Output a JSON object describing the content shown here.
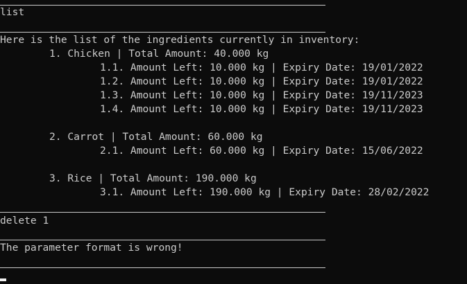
{
  "terminal": {
    "divider": "____________________________________________________________",
    "command_1": "list",
    "intro": "Here is the list of the ingredients currently in inventory:",
    "items": [
      {
        "header": "1. Chicken | Total Amount: 40.000 kg",
        "batches": [
          "1.1. Amount Left: 10.000 kg | Expiry Date: 19/01/2022",
          "1.2. Amount Left: 10.000 kg | Expiry Date: 19/01/2022",
          "1.3. Amount Left: 10.000 kg | Expiry Date: 19/11/2023",
          "1.4. Amount Left: 10.000 kg | Expiry Date: 19/11/2023"
        ]
      },
      {
        "header": "2. Carrot | Total Amount: 60.000 kg",
        "batches": [
          "2.1. Amount Left: 60.000 kg | Expiry Date: 15/06/2022"
        ]
      },
      {
        "header": "3. Rice | Total Amount: 190.000 kg",
        "batches": [
          "3.1. Amount Left: 190.000 kg | Expiry Date: 28/02/2022"
        ]
      }
    ],
    "command_2": "delete 1",
    "error_message": "The parameter format is wrong!"
  }
}
